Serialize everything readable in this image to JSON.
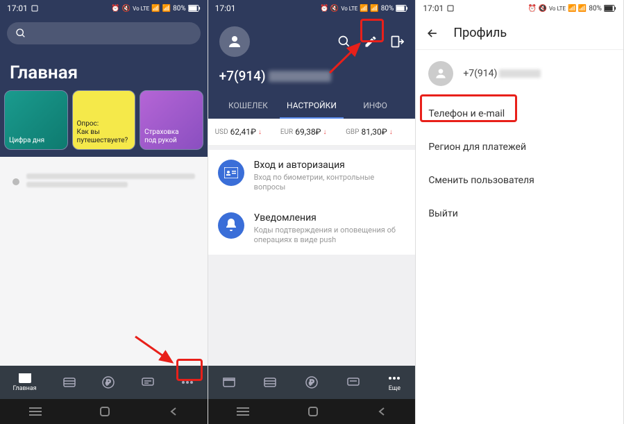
{
  "status": {
    "time": "17:01",
    "battery": "80%"
  },
  "screen1": {
    "title": "Главная",
    "cards": [
      {
        "label": "Цифра дня"
      },
      {
        "label": "Опрос:\nКак вы\nпутешествуете?"
      },
      {
        "label": "Страховка\nпод рукой"
      }
    ],
    "nav": {
      "home": "Главная"
    }
  },
  "screen2": {
    "phone_prefix": "+7(914)",
    "tabs": {
      "wallet": "КОШЕЛЕК",
      "settings": "НАСТРОЙКИ",
      "info": "ИНФО"
    },
    "rates": [
      {
        "cur": "USD",
        "val": "62,41₽"
      },
      {
        "cur": "EUR",
        "val": "69,38₽"
      },
      {
        "cur": "GBP",
        "val": "81,30₽"
      }
    ],
    "settings": {
      "auth": {
        "title": "Вход и авторизация",
        "sub": "Вход по биометрии, контрольные вопросы"
      },
      "notif": {
        "title": "Уведомления",
        "sub": "Коды подтверждения и оповещения об операциях в виде push"
      }
    },
    "nav": {
      "more": "Еще"
    }
  },
  "screen3": {
    "title": "Профиль",
    "phone_prefix": "+7(914)",
    "menu": {
      "phone_email": "Телефон и e-mail",
      "region": "Регион для платежей",
      "switch_user": "Сменить пользователя",
      "logout": "Выйти"
    }
  }
}
